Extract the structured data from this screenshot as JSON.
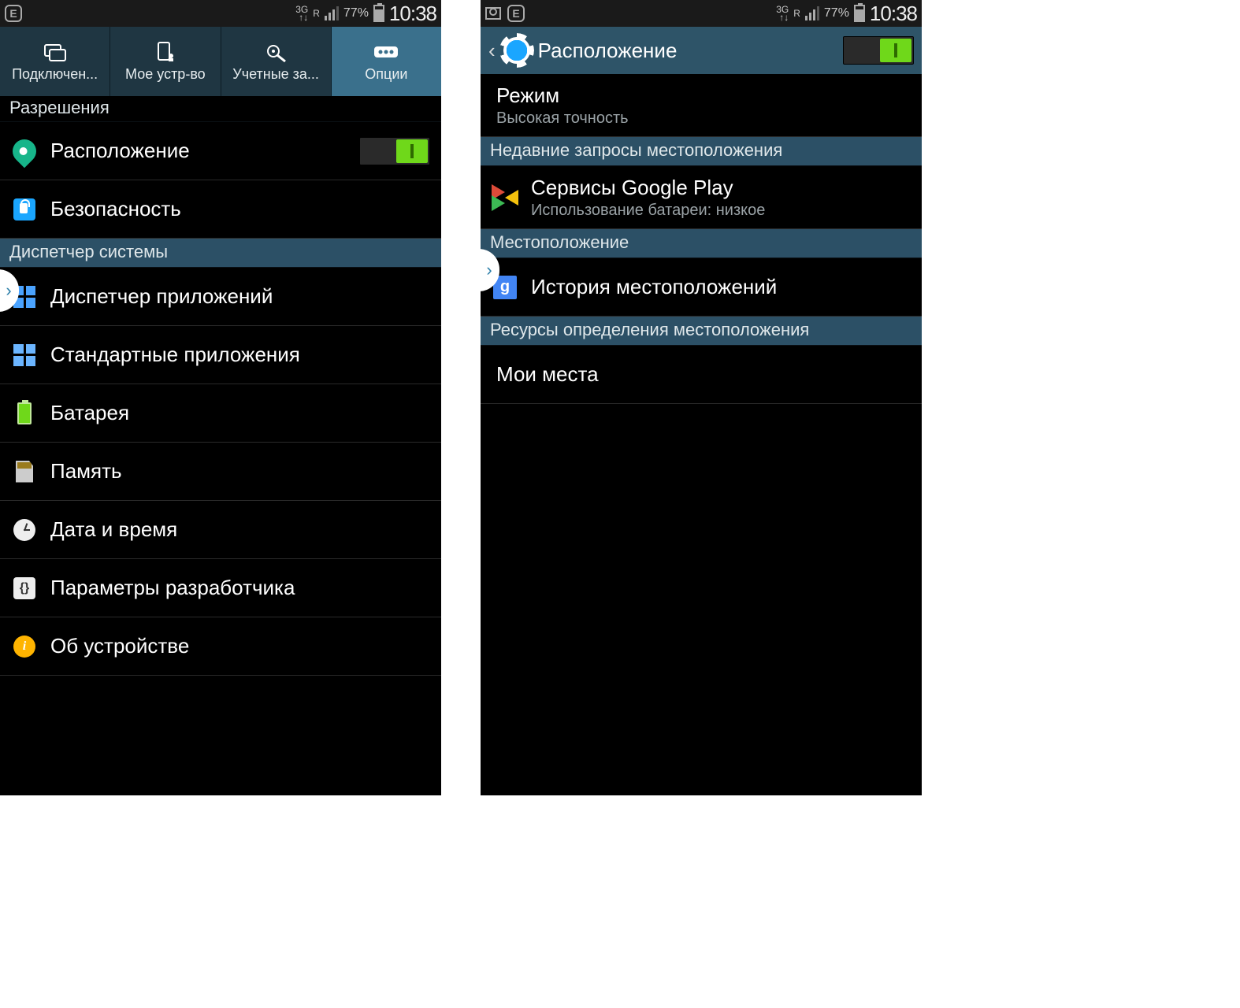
{
  "status": {
    "network_gen": "3G",
    "roaming": "R",
    "battery_pct": "77%",
    "time": "10:38"
  },
  "screen1": {
    "tabs": {
      "connections": "Подключен...",
      "my_device": "Мое устр-во",
      "accounts": "Учетные за...",
      "options": "Опции"
    },
    "sections": {
      "permissions": "Разрешения",
      "system_mgr": "Диспетчер системы"
    },
    "rows": {
      "location": "Расположение",
      "security": "Безопасность",
      "app_mgr": "Диспетчер приложений",
      "default_apps": "Стандартные приложения",
      "battery": "Батарея",
      "memory": "Память",
      "datetime": "Дата и время",
      "developer": "Параметры разработчика",
      "about": "Об устройстве"
    }
  },
  "screen2": {
    "title": "Расположение",
    "mode": {
      "label": "Режим",
      "value": "Высокая точность"
    },
    "sections": {
      "recent": "Недавние запросы местоположения",
      "location": "Местоположение",
      "sources": "Ресурсы определения местоположения"
    },
    "play": {
      "title": "Сервисы Google Play",
      "sub": "Использование батареи: низкое"
    },
    "history": "История местоположений",
    "my_places": "Мои места"
  }
}
